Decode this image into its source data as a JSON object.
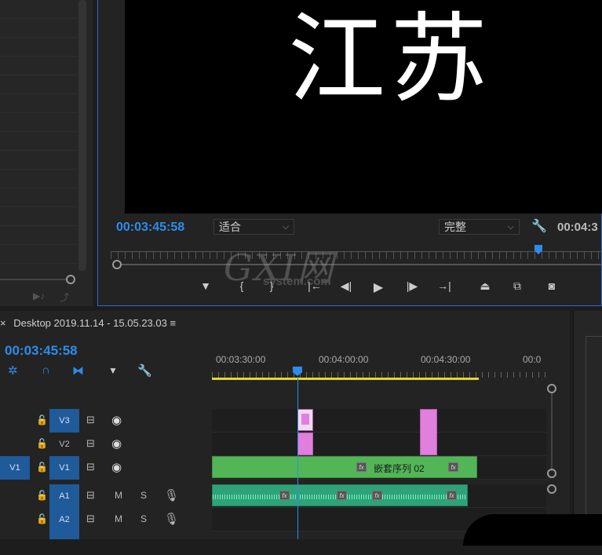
{
  "program_monitor": {
    "frame_text": "江苏",
    "timecode": "00:03:45:58",
    "zoom_dropdown": "适合",
    "quality_dropdown": "完整",
    "duration_timecode": "00:04:3",
    "transport_icons": [
      "marker-icon",
      "mark-in-icon",
      "mark-out-icon",
      "go-to-in-icon",
      "step-back-icon",
      "play-icon",
      "step-forward-icon",
      "go-to-out-icon",
      "lift-icon",
      "extract-icon",
      "camera-icon"
    ]
  },
  "watermark": {
    "big": "GXI网",
    "small": "system.com"
  },
  "timeline": {
    "close": "×",
    "title": "Desktop 2019.11.14 - 15.05.23.03",
    "menu": "≡",
    "timecode": "00:03:45:58",
    "ruler_labels": [
      "00:03:30:00",
      "00:04:00:00",
      "00:04:30:00",
      "00:0"
    ],
    "tracks": {
      "v3": "V3",
      "v2": "V2",
      "v1": "V1",
      "v1_target": "V1",
      "a1": "A1",
      "a2": "A2",
      "m": "M",
      "s": "S"
    },
    "clips": {
      "nested_sequence": "嵌套序列 02",
      "fx": "fx"
    }
  },
  "colors": {
    "accent": "#2d8ceb",
    "video_clip": "#52b656",
    "audio_clip": "#2ea37a",
    "graphic_clip": "#e07fde",
    "work_area": "#e6d62a"
  }
}
